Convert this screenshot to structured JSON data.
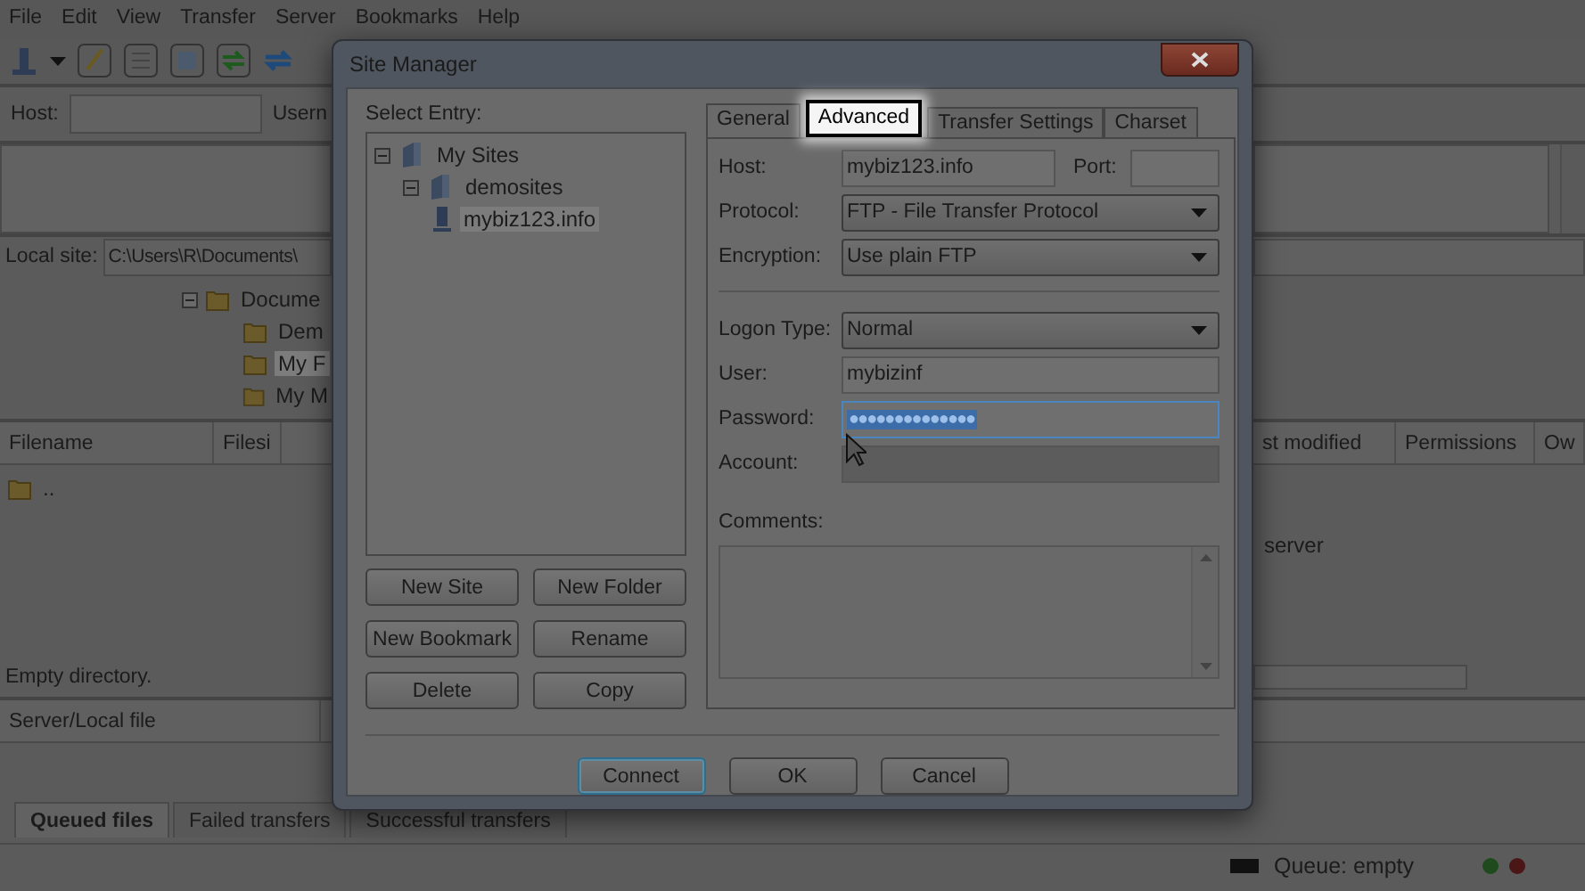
{
  "menu": [
    "File",
    "Edit",
    "View",
    "Transfer",
    "Server",
    "Bookmarks",
    "Help"
  ],
  "quickconnect": {
    "host_label": "Host:",
    "user_label": "Usern"
  },
  "local_site": {
    "label": "Local site:",
    "path": "C:\\Users\\R\\Documents\\"
  },
  "local_tree": [
    {
      "label": "Docume",
      "expanded": true,
      "selected": false,
      "children": [
        {
          "label": "Dem",
          "selected": false
        },
        {
          "label": "My F",
          "selected": true
        },
        {
          "label": "My M",
          "selected": false
        }
      ]
    }
  ],
  "local_columns": [
    "Filename",
    "Filesi"
  ],
  "local_files": [
    ".."
  ],
  "local_status": "Empty directory.",
  "remote_columns": [
    "st modified",
    "Permissions",
    "Ow"
  ],
  "remote_message": "server",
  "queue_columns": [
    "Server/Local file"
  ],
  "queue_tabs": [
    {
      "label": "Queued files",
      "selected": true
    },
    {
      "label": "Failed transfers",
      "selected": false
    },
    {
      "label": "Successful transfers",
      "selected": false
    }
  ],
  "status_bar": {
    "queue": "Queue: empty"
  },
  "dialog": {
    "title": "Site Manager",
    "select_entry_label": "Select Entry:",
    "tree": [
      {
        "label": "My Sites",
        "kind": "root",
        "expanded": true,
        "selected": false,
        "children": [
          {
            "label": "demosites",
            "kind": "folder",
            "expanded": true,
            "selected": false,
            "children": [
              {
                "label": "mybiz123.info",
                "kind": "site",
                "selected": true
              }
            ]
          }
        ]
      }
    ],
    "entry_buttons": [
      "New Site",
      "New Folder",
      "New Bookmark",
      "Rename",
      "Delete",
      "Copy"
    ],
    "tabs": [
      {
        "label": "General",
        "selected": true,
        "highlighted": false
      },
      {
        "label": "Advanced",
        "selected": false,
        "highlighted": true
      },
      {
        "label": "Transfer Settings",
        "selected": false,
        "highlighted": false
      },
      {
        "label": "Charset",
        "selected": false,
        "highlighted": false
      }
    ],
    "host": {
      "label": "Host:",
      "value": "mybiz123.info"
    },
    "port": {
      "label": "Port:"
    },
    "fields": [
      {
        "kind": "select",
        "label": "Protocol:",
        "value": "FTP - File Transfer Protocol",
        "focused": false,
        "disabled": false
      },
      {
        "kind": "select",
        "label": "Encryption:",
        "value": "Use plain FTP",
        "focused": false,
        "disabled": false
      },
      {
        "kind": "separator"
      },
      {
        "kind": "select",
        "label": "Logon Type:",
        "value": "Normal",
        "focused": false,
        "disabled": false
      },
      {
        "kind": "text",
        "label": "User:",
        "value": "mybizinf",
        "focused": false,
        "disabled": false
      },
      {
        "kind": "password",
        "label": "Password:",
        "value": "●●●●●●●●●●●●●●",
        "focused": true,
        "disabled": false
      },
      {
        "kind": "text",
        "label": "Account:",
        "focused": false,
        "disabled": true
      }
    ],
    "comments_label": "Comments:",
    "buttons": [
      {
        "label": "Connect",
        "focused": true
      },
      {
        "label": "OK",
        "focused": false
      },
      {
        "label": "Cancel",
        "focused": false
      }
    ]
  }
}
